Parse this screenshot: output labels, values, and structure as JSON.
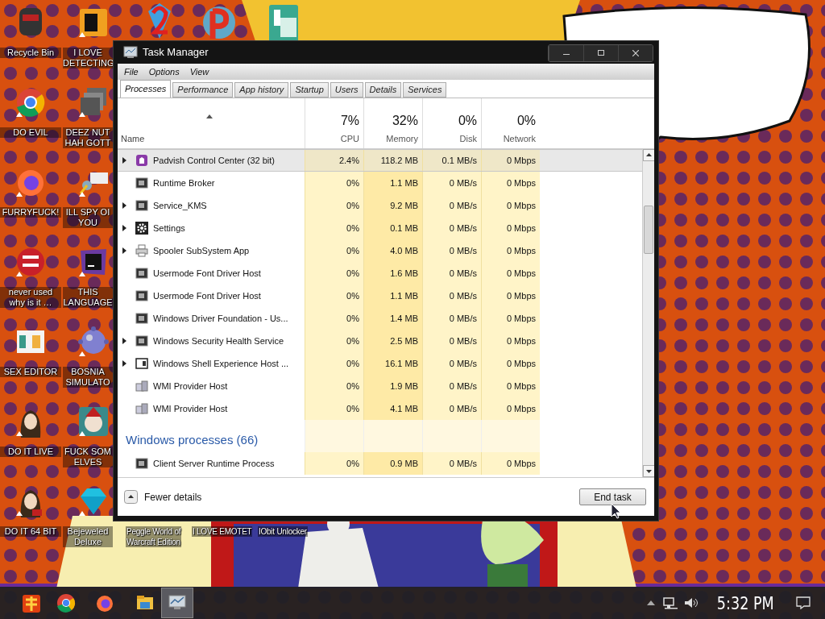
{
  "desktop_columns": [
    [
      {
        "label": "Recycle Bin",
        "shortcut": false
      },
      {
        "label": "DO EVIL",
        "shortcut": true
      },
      {
        "label": "FURRYFUCK!",
        "shortcut": true
      },
      {
        "label": "never used why is it …",
        "shortcut": true
      },
      {
        "label": "SEX EDITOR",
        "shortcut": false
      },
      {
        "label": "DO IT LIVE",
        "shortcut": true
      },
      {
        "label": "DO IT 64 BIT",
        "shortcut": true
      }
    ],
    [
      {
        "label": "I LOVE\nDETECTING",
        "shortcut": true
      },
      {
        "label": "DEEZ NUT\nHAH GOTT",
        "shortcut": true
      },
      {
        "label": "ILL SPY OI\nYOU",
        "shortcut": true
      },
      {
        "label": "THIS\nLANGUAGE",
        "shortcut": true
      },
      {
        "label": "BOSNIA\nSIMULATO",
        "shortcut": true
      },
      {
        "label": "FUCK SOM\nELVES",
        "shortcut": true
      },
      {
        "label": "Bejeweled\nDeluxe",
        "shortcut": true
      }
    ]
  ],
  "bottom_labels": [
    "Peggle World of\nWarcraft Edition",
    "I LOVE EMOTET",
    "IObit Unlocker"
  ],
  "window": {
    "title": "Task Manager",
    "menu": [
      "File",
      "Options",
      "View"
    ],
    "tabs": [
      {
        "label": "Processes",
        "selected": true
      },
      {
        "label": "Performance",
        "selected": false
      },
      {
        "label": "App history",
        "selected": false
      },
      {
        "label": "Startup",
        "selected": false
      },
      {
        "label": "Users",
        "selected": false
      },
      {
        "label": "Details",
        "selected": false
      },
      {
        "label": "Services",
        "selected": false
      }
    ],
    "columns": [
      {
        "label": "Name"
      },
      {
        "value": "7%",
        "label": "CPU"
      },
      {
        "value": "32%",
        "label": "Memory"
      },
      {
        "value": "0%",
        "label": "Disk"
      },
      {
        "value": "0%",
        "label": "Network"
      }
    ],
    "rows": [
      {
        "kind": "app",
        "name": "Padvish Control Center (32 bit)",
        "expandable": true,
        "selected": true,
        "cpu": "2.4%",
        "memory": "118.2 MB",
        "disk": "0.1 MB/s",
        "network": "0 Mbps"
      },
      {
        "kind": "service",
        "name": "Runtime Broker",
        "expandable": false,
        "selected": false,
        "cpu": "0%",
        "memory": "1.1 MB",
        "disk": "0 MB/s",
        "network": "0 Mbps"
      },
      {
        "kind": "service",
        "name": "Service_KMS",
        "expandable": true,
        "selected": false,
        "cpu": "0%",
        "memory": "9.2 MB",
        "disk": "0 MB/s",
        "network": "0 Mbps"
      },
      {
        "kind": "settings",
        "name": "Settings",
        "expandable": true,
        "selected": false,
        "cpu": "0%",
        "memory": "0.1 MB",
        "disk": "0 MB/s",
        "network": "0 Mbps"
      },
      {
        "kind": "printer",
        "name": "Spooler SubSystem App",
        "expandable": true,
        "selected": false,
        "cpu": "0%",
        "memory": "4.0 MB",
        "disk": "0 MB/s",
        "network": "0 Mbps"
      },
      {
        "kind": "service",
        "name": "Usermode Font Driver Host",
        "expandable": false,
        "selected": false,
        "cpu": "0%",
        "memory": "1.6 MB",
        "disk": "0 MB/s",
        "network": "0 Mbps"
      },
      {
        "kind": "service",
        "name": "Usermode Font Driver Host",
        "expandable": false,
        "selected": false,
        "cpu": "0%",
        "memory": "1.1 MB",
        "disk": "0 MB/s",
        "network": "0 Mbps"
      },
      {
        "kind": "service",
        "name": "Windows Driver Foundation - Us...",
        "expandable": false,
        "selected": false,
        "cpu": "0%",
        "memory": "1.4 MB",
        "disk": "0 MB/s",
        "network": "0 Mbps"
      },
      {
        "kind": "service",
        "name": "Windows Security Health Service",
        "expandable": true,
        "selected": false,
        "cpu": "0%",
        "memory": "2.5 MB",
        "disk": "0 MB/s",
        "network": "0 Mbps"
      },
      {
        "kind": "shell",
        "name": "Windows Shell Experience Host ...",
        "expandable": true,
        "selected": false,
        "cpu": "0%",
        "memory": "16.1 MB",
        "disk": "0 MB/s",
        "network": "0 Mbps"
      },
      {
        "kind": "wmi",
        "name": "WMI Provider Host",
        "expandable": false,
        "selected": false,
        "cpu": "0%",
        "memory": "1.9 MB",
        "disk": "0 MB/s",
        "network": "0 Mbps"
      },
      {
        "kind": "wmi",
        "name": "WMI Provider Host",
        "expandable": false,
        "selected": false,
        "cpu": "0%",
        "memory": "4.1 MB",
        "disk": "0 MB/s",
        "network": "0 Mbps"
      },
      {
        "kind": "group",
        "name": "Windows processes (66)"
      },
      {
        "kind": "service",
        "name": "Client Server Runtime Process",
        "expandable": false,
        "selected": false,
        "cpu": "0%",
        "memory": "0.9 MB",
        "disk": "0 MB/s",
        "network": "0 Mbps"
      }
    ],
    "fewer_details": "Fewer details",
    "end_task": "End task"
  },
  "taskbar": {
    "apps": [
      {
        "active": false
      },
      {
        "active": false
      },
      {
        "active": false
      },
      {
        "active": false
      },
      {
        "active": true
      }
    ],
    "time": "5:32 PM"
  }
}
